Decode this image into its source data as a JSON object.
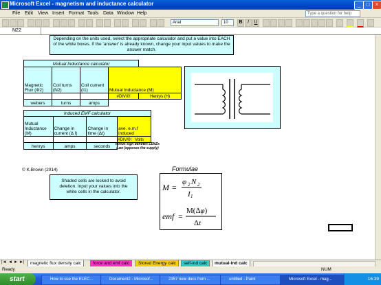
{
  "window": {
    "title": "Microsoft Excel - magnetism and inductance calculator"
  },
  "menu": [
    "File",
    "Edit",
    "View",
    "Insert",
    "Format",
    "Tools",
    "Data",
    "Window",
    "Help"
  ],
  "help_placeholder": "Type a question for help",
  "toolbar": {
    "font": "Arial",
    "size": "10"
  },
  "name_box": "N22",
  "instructions": "Depending on the units used, select the appropriate calculator and put a value into EACH of the white boxes. If the 'answer' is already known, change your input values to make the answer match.",
  "mutual": {
    "title": "Mutual Inductance calculator",
    "headers": [
      "Magnetic Flux (Φ2)",
      "Coil turns (N2)",
      "Coil current (I1)",
      "Mutual Inductance (M)"
    ],
    "result": "#DIV/0!",
    "result_unit": "Henrys (H)",
    "units": [
      "webers",
      "turns",
      "amps"
    ]
  },
  "emf": {
    "title": "Induced EMF calculator",
    "headers": [
      "Mutual Inductance (M)",
      "Change in current (Δ I)",
      "Change in time (Δt)",
      "ave. e.m.f induced"
    ],
    "result": "#DIV/0!",
    "result_unit": "Volts",
    "units": [
      "henrys",
      "amps",
      "seconds"
    ],
    "note": "minus sign denotes LENZs Law (opposes the supply)"
  },
  "copyright": "© K.Brown (2014)",
  "locked_note": "Shaded cells are locked to avoid deletion. Input your values into the white cells in the calculator.",
  "formulae_title": "Formulae",
  "tabs": [
    "magnetic flux density calc",
    "force and emf calc",
    "Stored Energy calc",
    "self-ind calc",
    "mutual-ind calc"
  ],
  "active_tab": "mutual-ind calc",
  "status": {
    "left": "Ready",
    "right": "NUM"
  },
  "taskbar": {
    "start": "start",
    "tasks": [
      "How to use the ELEC...",
      "Document2 - Microsof...",
      "2357 new docs from ...",
      "untitled - Paint",
      "Microsoft Excel - mag..."
    ],
    "clock": "16:39"
  },
  "colors": {
    "cell_fill": "#ccffff",
    "result_fill": "#ffff00",
    "taskbar": "#245edb"
  }
}
